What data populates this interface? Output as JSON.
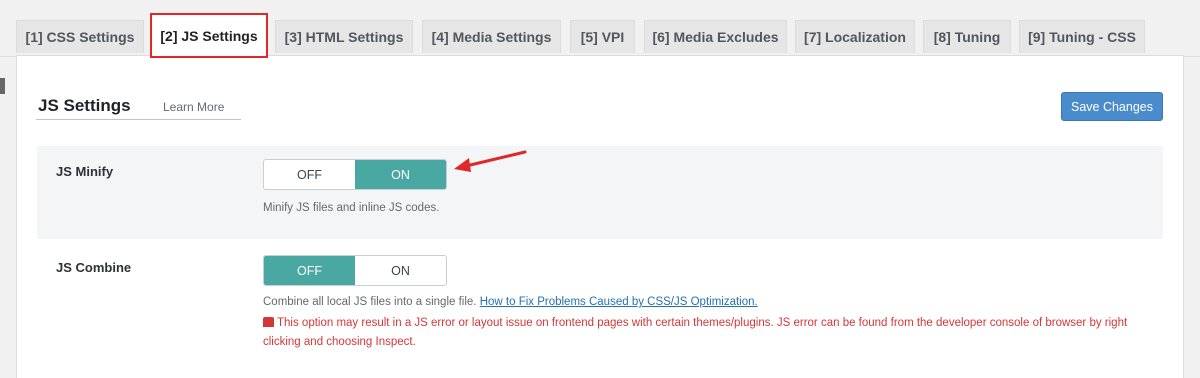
{
  "tabs": [
    {
      "label": "[1] CSS Settings"
    },
    {
      "label": "[2] JS Settings"
    },
    {
      "label": "[3] HTML Settings"
    },
    {
      "label": "[4] Media Settings"
    },
    {
      "label": "[5] VPI"
    },
    {
      "label": "[6] Media Excludes"
    },
    {
      "label": "[7] Localization"
    },
    {
      "label": "[8] Tuning"
    },
    {
      "label": "[9] Tuning - CSS"
    }
  ],
  "active_tab": "[2] JS Settings",
  "section": {
    "title": "JS Settings",
    "learn_more": "Learn More",
    "save_label": "Save Changes"
  },
  "settings": {
    "minify": {
      "label": "JS Minify",
      "off_label": "OFF",
      "on_label": "ON",
      "state": "ON",
      "description": "Minify JS files and inline JS codes."
    },
    "combine": {
      "label": "JS Combine",
      "off_label": "OFF",
      "on_label": "ON",
      "state": "OFF",
      "description": "Combine all local JS files into a single file.",
      "help_link": "How to Fix Problems Caused by CSS/JS Optimization.",
      "warning": "This option may result in a JS error or layout issue on frontend pages with certain themes/plugins. JS error can be found from the developer console of browser by right clicking and choosing Inspect."
    }
  },
  "colors": {
    "toggle_active": "#4aa8a3",
    "save_button": "#4a8ccb",
    "highlight": "#e0282b",
    "warning_text": "#d63638",
    "link": "#2271b1"
  },
  "icons": {
    "warning": "warning-light-icon",
    "annotation": "red-arrow-annotation"
  }
}
